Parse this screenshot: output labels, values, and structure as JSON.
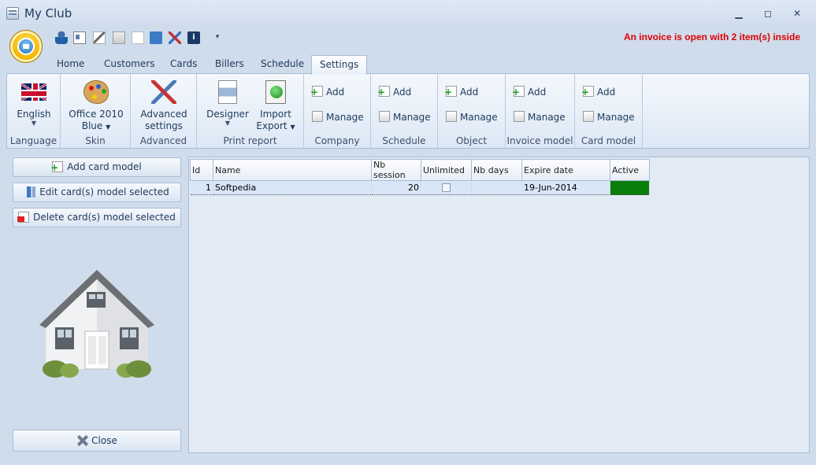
{
  "window": {
    "title": "My Club"
  },
  "status": {
    "invoice_message": "An invoice is open with 2 item(s) inside",
    "invoice_color": "#e00000"
  },
  "tabs": [
    {
      "label": "Home"
    },
    {
      "label": "Customers"
    },
    {
      "label": "Cards"
    },
    {
      "label": "Billers"
    },
    {
      "label": "Schedule"
    },
    {
      "label": "Settings",
      "active": true
    }
  ],
  "ribbon": {
    "language": {
      "button": "English",
      "group": "Language"
    },
    "skin": {
      "button_line1": "Office 2010",
      "button_line2": "Blue",
      "group": "Skin"
    },
    "advanced": {
      "button_line1": "Advanced",
      "button_line2": "settings",
      "group": "Advanced"
    },
    "print_report": {
      "designer": "Designer",
      "import_line1": "Import",
      "import_line2": "Export",
      "group": "Print report"
    },
    "company": {
      "add": "Add",
      "manage": "Manage",
      "group": "Company"
    },
    "schedule": {
      "add": "Add",
      "manage": "Manage",
      "group": "Schedule"
    },
    "object": {
      "add": "Add",
      "manage": "Manage",
      "group": "Object"
    },
    "invoice_model": {
      "add": "Add",
      "manage": "Manage",
      "group": "Invoice model"
    },
    "card_model": {
      "add": "Add",
      "manage": "Manage",
      "group": "Card model"
    }
  },
  "left": {
    "add_button": "Add card model",
    "edit_button": "Edit card(s) model selected",
    "delete_button": "Delete card(s) model selected",
    "close_button": "Close"
  },
  "grid": {
    "columns": [
      "Id",
      "Name",
      "Nb session",
      "Unlimited",
      "Nb days",
      "Expire date",
      "Active"
    ],
    "rows": [
      {
        "id": "1",
        "name": "Softpedia",
        "nb_session": "20",
        "unlimited": false,
        "nb_days": "",
        "expire_date": "19-Jun-2014",
        "active_color": "#0a7e0a"
      }
    ]
  }
}
